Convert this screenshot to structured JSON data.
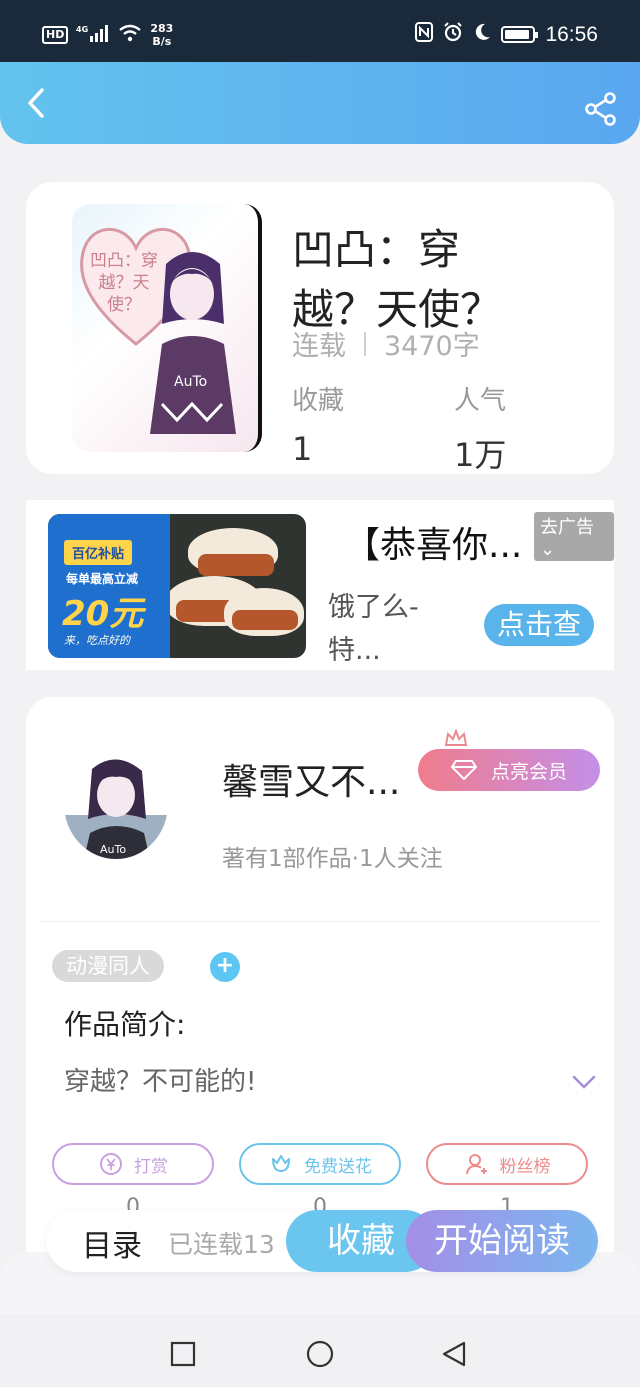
{
  "status_bar": {
    "hd": "HD",
    "network": "4G",
    "speed_value": "283",
    "speed_unit": "B/s",
    "time": "16:56"
  },
  "book": {
    "title": "凹凸：穿越？天使？",
    "status": "连载",
    "word_count": "3470字",
    "stats": [
      {
        "label": "收藏",
        "value": "1"
      },
      {
        "label": "人气",
        "value": "1万"
      }
    ],
    "cover_text": "凹凸：穿越？天使？"
  },
  "ad": {
    "title": "【恭喜你...",
    "close_label": "去广告",
    "description": "饿了么-特...",
    "cta": "点击查",
    "image": {
      "tag": "百亿补贴",
      "subtitle": "每单最高立减",
      "amount": "20元",
      "footer": "来，吃点好的"
    }
  },
  "author": {
    "name": "馨雪又不...",
    "vip_label": "点亮会员",
    "subtitle": "著有1部作品·1人关注",
    "tag": "动漫同人",
    "intro_title": "作品简介:",
    "intro_text": "穿越？不可能的!"
  },
  "actions": [
    {
      "label": "打赏",
      "count": "0",
      "color": "#c8a0e0"
    },
    {
      "label": "免费送花",
      "count": "0",
      "color": "#6cc4ec"
    },
    {
      "label": "粉丝榜",
      "count": "1",
      "color": "#ee8c8c"
    }
  ],
  "bottom_bar": {
    "toc": "目录",
    "serial": "已连载13",
    "favorite": "收藏",
    "read": "开始阅读"
  }
}
